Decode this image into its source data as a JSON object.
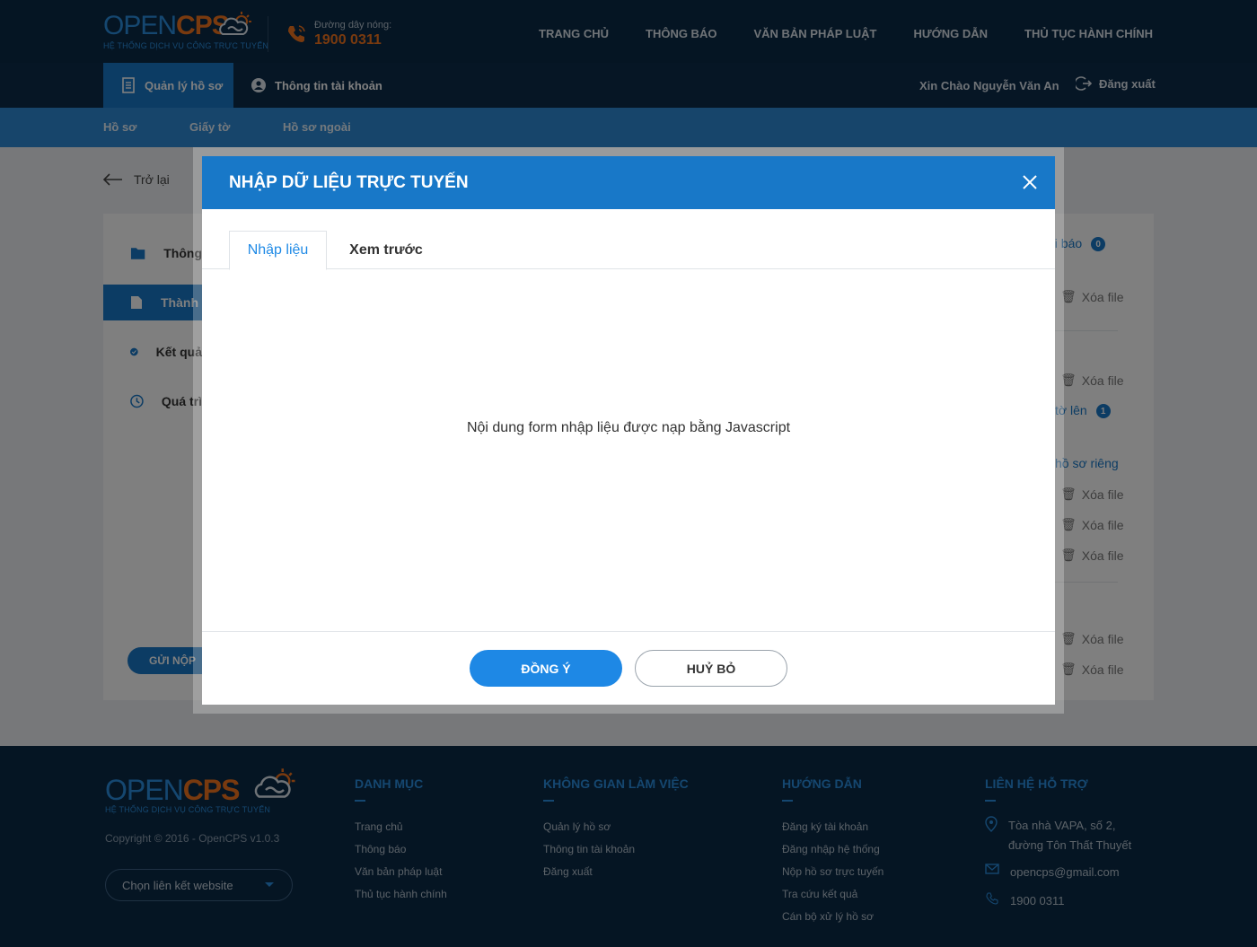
{
  "brand": {
    "word_open": "OPEN",
    "word_cps": "CPS",
    "tagline": "HỆ THỐNG DỊCH VỤ CÔNG TRỰC TUYẾN"
  },
  "hotline": {
    "label": "Đường dây nóng:",
    "number": "1900 0311"
  },
  "nav": [
    "TRANG CHỦ",
    "THÔNG BÁO",
    "VĂN BẢN PHÁP LUẬT",
    "HƯỚNG DẪN",
    "THỦ TỤC HÀNH CHÍNH"
  ],
  "subnav": {
    "manage_label": "Quản lý hồ sơ",
    "account_label": "Thông tin tài khoản",
    "greeting": "Xin Chào Nguyễn Văn An",
    "logout_label": "Đăng xuất"
  },
  "bluebar_tabs": [
    "Hồ sơ",
    "Giấy tờ",
    "Hồ sơ ngoài"
  ],
  "back_label": "Trở lại",
  "sidebar": [
    "Thông",
    "Thành",
    "Kết quả",
    "Quá trì"
  ],
  "send_button": "GỬI NỘP",
  "right_column": {
    "notify_link": "ai báo",
    "notify_count": "0",
    "uploaded_link": "tờ lên",
    "uploaded_count": "1",
    "private_link": "hồ sơ riêng",
    "delete_label": "Xóa file"
  },
  "footer": {
    "copyright": "Copyright © 2016 - OpenCPS v1.0.3",
    "select_placeholder": "Chọn liên kết website",
    "cols": [
      {
        "title": "DANH MỤC",
        "links": [
          "Trang chủ",
          "Thông báo",
          "Văn bản pháp luật",
          "Thủ tục hành chính"
        ]
      },
      {
        "title": "KHÔNG GIAN LÀM VIỆC",
        "links": [
          "Quản lý hồ sơ",
          "Thông tin tài khoản",
          "Đăng xuất"
        ]
      },
      {
        "title": "HƯỚNG DẪN",
        "links": [
          "Đăng ký tài khoản",
          "Đăng nhập hệ thống",
          "Nộp hồ sơ trực tuyến",
          "Tra cứu kết quả",
          "Cán bộ xử lý hồ sơ"
        ]
      }
    ],
    "contact": {
      "title": "LIÊN HỆ HỖ TRỢ",
      "address_line1": "Tòa nhà VAPA, số 2,",
      "address_line2": "đường Tôn Thất Thuyết",
      "email": "opencps@gmail.com",
      "phone": "1900 0311"
    }
  },
  "modal": {
    "title": "NHẬP DỮ LIỆU TRỰC TUYẾN",
    "tab_input": "Nhập liệu",
    "tab_preview": "Xem trước",
    "body_text": "Nội dung form nhập liệu được nạp bằng Javascript",
    "ok_label": "ĐỒNG Ý",
    "cancel_label": "HUỶ BỎ"
  }
}
